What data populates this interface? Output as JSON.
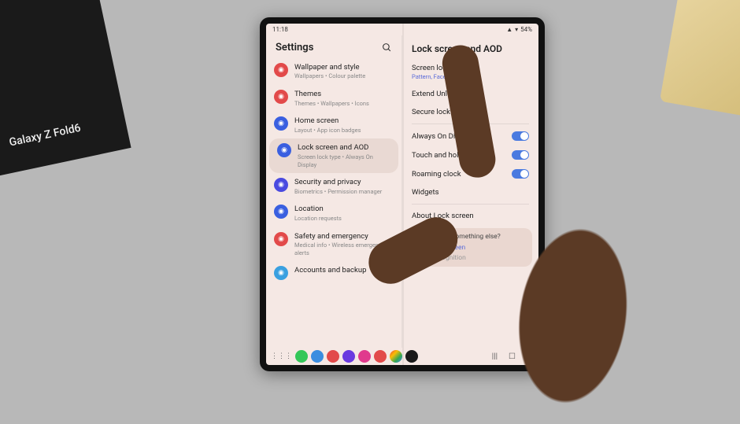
{
  "ambient": {
    "box_text": "Galaxy Z Fold6"
  },
  "statusbar": {
    "time": "11:18",
    "battery": "54%"
  },
  "left": {
    "title": "Settings",
    "items": [
      {
        "icon_color": "#e24a4a",
        "title": "Wallpaper and style",
        "subtitle": "Wallpapers • Colour palette"
      },
      {
        "icon_color": "#e24a4a",
        "title": "Themes",
        "subtitle": "Themes • Wallpapers • Icons"
      },
      {
        "icon_color": "#3a5fe0",
        "title": "Home screen",
        "subtitle": "Layout • App icon badges"
      },
      {
        "icon_color": "#3a5fe0",
        "title": "Lock screen and AOD",
        "subtitle": "Screen lock type • Always On Display"
      },
      {
        "icon_color": "#4a4ae0",
        "title": "Security and privacy",
        "subtitle": "Biometrics • Permission manager"
      },
      {
        "icon_color": "#3a5fe0",
        "title": "Location",
        "subtitle": "Location requests"
      },
      {
        "icon_color": "#e24a4a",
        "title": "Safety and emergency",
        "subtitle": "Medical info • Wireless emergency alerts"
      },
      {
        "icon_color": "#3aa0e0",
        "title": "Accounts and backup",
        "subtitle": ""
      }
    ],
    "selected_index": 3
  },
  "right": {
    "title": "Lock screen and AOD",
    "group1": [
      {
        "title": "Screen lock type",
        "subtitle": "Pattern, Face, Fingerprints"
      },
      {
        "title": "Extend Unlock"
      },
      {
        "title": "Secure lock settings"
      }
    ],
    "group2": [
      {
        "title": "Always On Display",
        "switch": true
      },
      {
        "title": "Touch and hold to edit",
        "switch": true
      },
      {
        "title": "Roaming clock",
        "switch": true
      },
      {
        "title": "Widgets"
      }
    ],
    "group3": [
      {
        "title": "About Lock screen"
      }
    ],
    "footer": {
      "question": "Looking for something else?",
      "link1": "Edit Lock screen",
      "link2": "Face recognition"
    }
  },
  "dock": {
    "apps": [
      {
        "color": "#34c759"
      },
      {
        "color": "#3a8de0"
      },
      {
        "color": "#e24a4a"
      },
      {
        "color": "#6a3ae0"
      },
      {
        "color": "#e03a8d"
      },
      {
        "color": "#e24a4a"
      },
      {
        "color": "linear"
      },
      {
        "color": "#1a1a1a"
      }
    ],
    "nav": {
      "recent": "|||",
      "home": "☐",
      "back": "‹"
    }
  }
}
